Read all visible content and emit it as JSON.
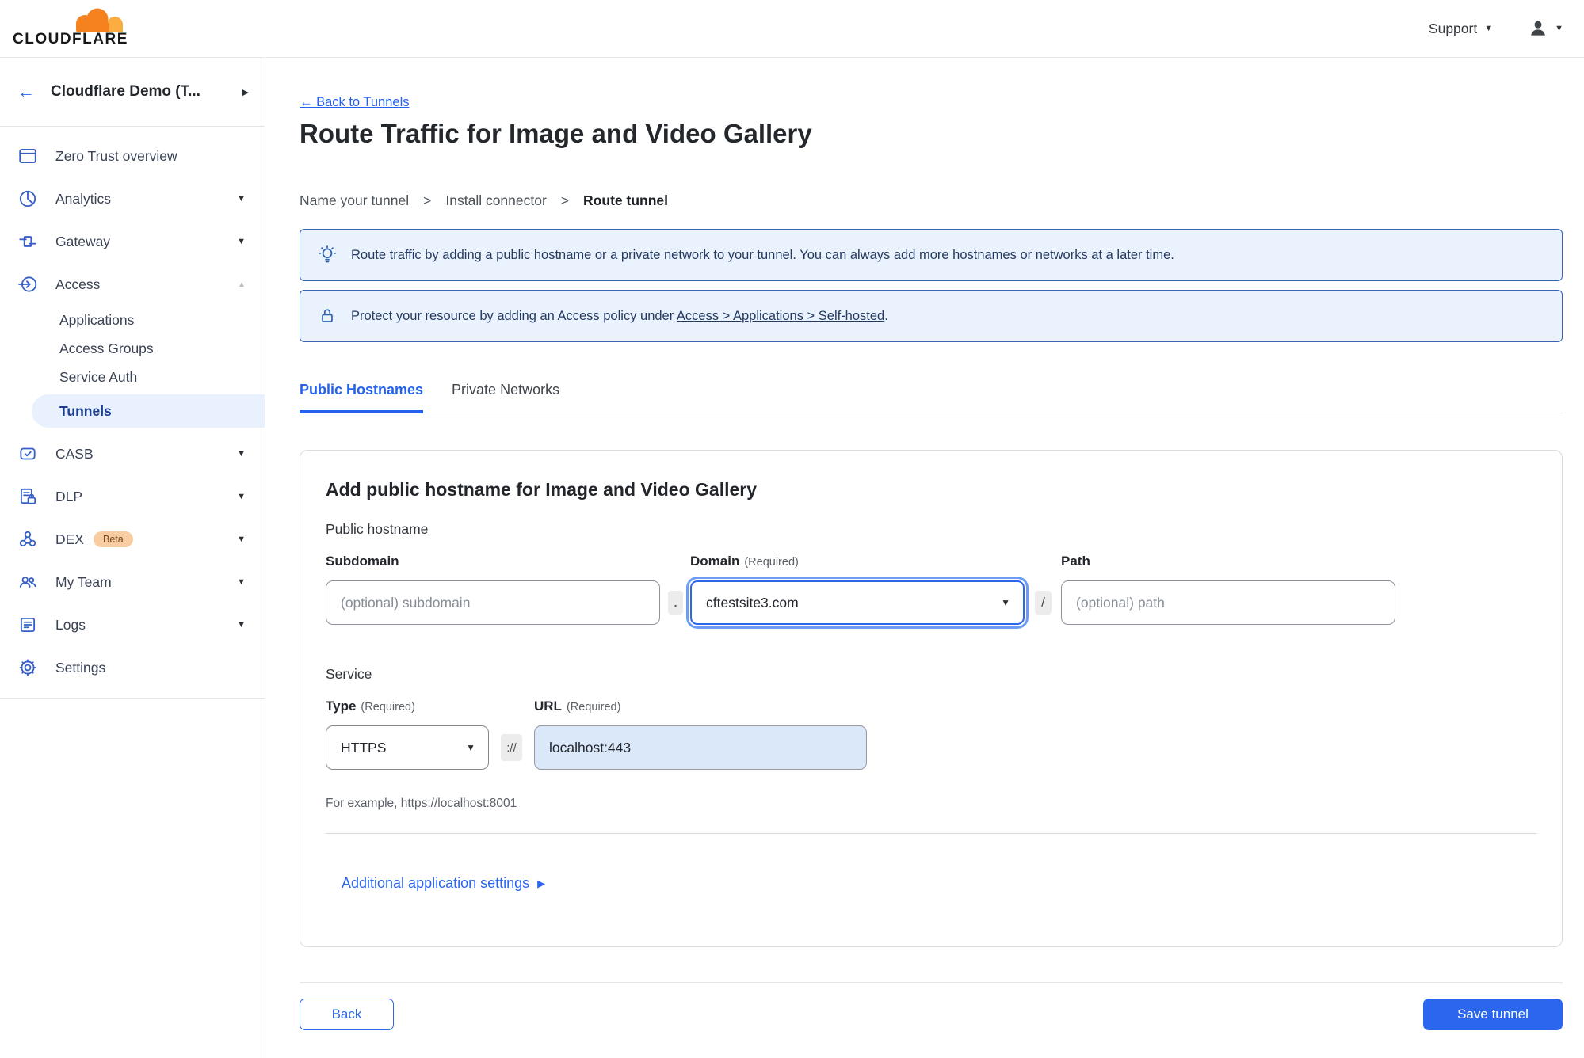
{
  "colors": {
    "accent_blue": "#2a66ee",
    "banner_bg": "#e9f2fd",
    "banner_border": "#3866ad",
    "active_pill_bg": "#e8f1fd",
    "logo_orange": "#f6821f",
    "logo_light_orange": "#fbad41",
    "beta_badge_bg": "#f8cda2"
  },
  "icons": {
    "chevron_down": "▼",
    "chevron_up": "▲",
    "chevron_right": "▶",
    "back_arrow": "←"
  },
  "topbar": {
    "brand": "CLOUDFLARE",
    "support_label": "Support"
  },
  "sidebar": {
    "account_name": "Cloudflare Demo (T...",
    "items": [
      {
        "label": "Zero Trust overview"
      },
      {
        "label": "Analytics"
      },
      {
        "label": "Gateway"
      },
      {
        "label": "Access"
      },
      {
        "label": "CASB"
      },
      {
        "label": "DLP"
      },
      {
        "label": "DEX",
        "badge": "Beta"
      },
      {
        "label": "My Team"
      },
      {
        "label": "Logs"
      },
      {
        "label": "Settings"
      }
    ],
    "access_subitems": [
      {
        "label": "Applications"
      },
      {
        "label": "Access Groups"
      },
      {
        "label": "Service Auth"
      },
      {
        "label": "Tunnels",
        "active": true
      }
    ]
  },
  "main": {
    "back_link": "← Back to Tunnels",
    "title": "Route Traffic for Image and Video Gallery",
    "breadcrumbs": [
      "Name your tunnel",
      "Install connector",
      "Route tunnel"
    ],
    "breadcrumb_separator": ">",
    "banners": [
      {
        "text": "Route traffic by adding a public hostname or a private network to your tunnel. You can always add more hostnames or networks at a later time."
      },
      {
        "text_prefix": "Protect your resource by adding an Access policy under ",
        "link_text": "Access > Applications > Self-hosted",
        "text_suffix": "."
      }
    ],
    "tabs": [
      {
        "label": "Public Hostnames",
        "active": true
      },
      {
        "label": "Private Networks"
      }
    ],
    "card": {
      "heading": "Add public hostname for Image and Video Gallery",
      "public_hostname_label": "Public hostname",
      "required_label": "(Required)",
      "subdomain": {
        "label": "Subdomain",
        "placeholder": "(optional) subdomain",
        "value": ""
      },
      "domain": {
        "label": "Domain",
        "value": "cftestsite3.com"
      },
      "path": {
        "label": "Path",
        "placeholder": "(optional) path",
        "value": ""
      },
      "separators": {
        "dot": ".",
        "slash": "/",
        "scheme": "://"
      },
      "service_label": "Service",
      "type": {
        "label": "Type",
        "value": "HTTPS"
      },
      "url": {
        "label": "URL",
        "value": "localhost:443"
      },
      "example": "For example, https://localhost:8001",
      "additional_settings": "Additional application settings"
    },
    "buttons": {
      "back": "Back",
      "save": "Save tunnel"
    }
  }
}
